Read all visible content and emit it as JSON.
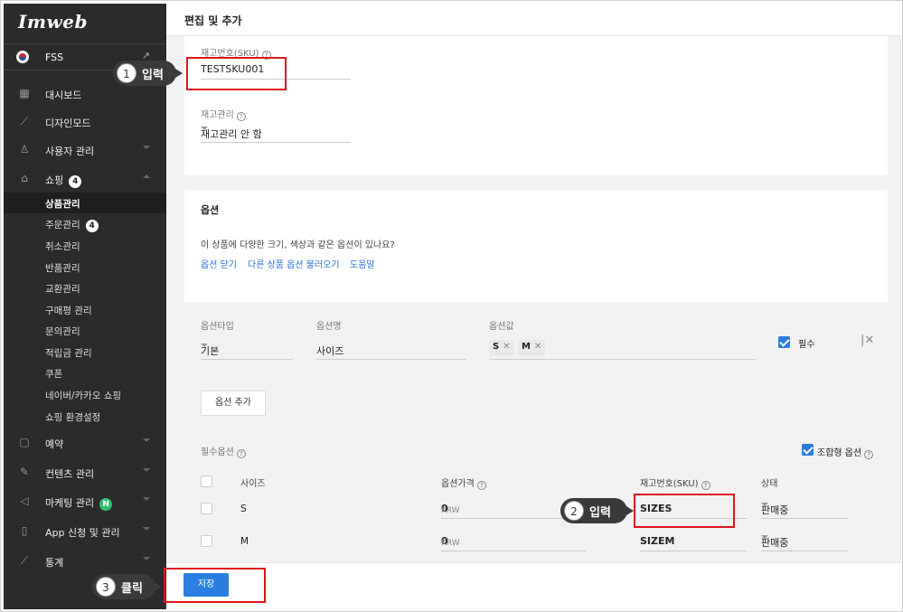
{
  "sidebar": {
    "logo": "Imweb",
    "site_name": "FSS",
    "nav": [
      {
        "label": "대시보드"
      },
      {
        "label": "디자인모드"
      },
      {
        "label": "사용자 관리"
      },
      {
        "label": "쇼핑",
        "badge": "4"
      },
      {
        "label": "예약"
      },
      {
        "label": "컨텐츠 관리"
      },
      {
        "label": "마케팅 관리",
        "badge": "N"
      },
      {
        "label": "App 신청 및 관리"
      },
      {
        "label": "통계"
      }
    ],
    "shop_sub": [
      {
        "label": "상품관리",
        "active": true
      },
      {
        "label": "주문관리",
        "badge": "4"
      },
      {
        "label": "취소관리"
      },
      {
        "label": "반품관리"
      },
      {
        "label": "교환관리"
      },
      {
        "label": "구매평 관리"
      },
      {
        "label": "문의관리"
      },
      {
        "label": "적립금 관리"
      },
      {
        "label": "쿠폰"
      },
      {
        "label": "네이버/카카오 쇼핑"
      },
      {
        "label": "쇼핑 환경설정"
      }
    ]
  },
  "header": {
    "title": "편집 및 추가"
  },
  "inventory": {
    "sku_label": "재고번호(SKU)",
    "sku_value": "TESTSKU001",
    "stock_label": "재고관리",
    "stock_value": "재고관리 안 함"
  },
  "options": {
    "title": "옵션",
    "question": "이 상품에 다양한 크기, 색상과 같은 옵션이 있나요?",
    "links": [
      "옵션 닫기",
      "다른 상품 옵션 불러오기",
      "도움말"
    ],
    "col_type": "옵션타입",
    "col_name": "옵션명",
    "col_values": "옵션값",
    "type_value": "기본",
    "name_value": "사이즈",
    "tags": [
      "S",
      "M"
    ],
    "required_label": "필수",
    "add_button": "옵션 추가",
    "required_options_label": "필수옵션",
    "combo_label": "조합형 옵션",
    "table": {
      "headers": [
        "사이즈",
        "옵션가격",
        "재고번호(SKU)",
        "상태"
      ],
      "rows": [
        {
          "size": "S",
          "currency": "KRW",
          "price": "0",
          "sku": "SIZES",
          "status": "판매중"
        },
        {
          "size": "M",
          "currency": "KRW",
          "price": "0",
          "sku": "SIZEM",
          "status": "판매중"
        }
      ]
    }
  },
  "footer": {
    "save_label": "저장"
  },
  "annotations": [
    {
      "num": "1",
      "text": "입력"
    },
    {
      "num": "2",
      "text": "입력"
    },
    {
      "num": "3",
      "text": "클릭"
    }
  ],
  "colors": {
    "accent": "#2a7de1",
    "highlight": "#e0141e",
    "sidebar_bg": "#2b2b2b"
  }
}
